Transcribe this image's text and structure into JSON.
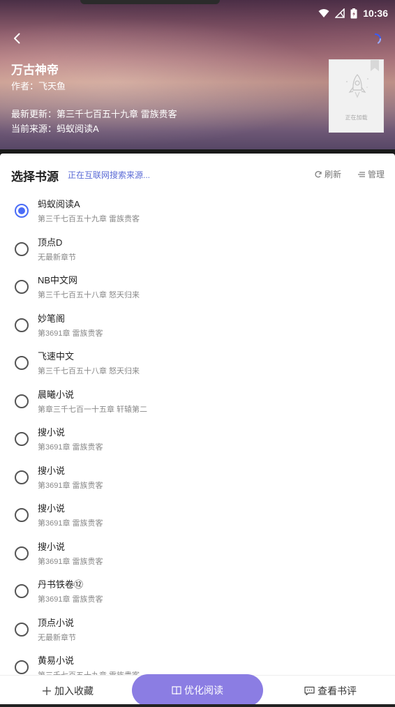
{
  "status_bar": {
    "time": "10:36"
  },
  "book": {
    "title": "万古神帝",
    "author": "作者：飞天鱼",
    "latest_update": "最新更新：第三千七百五十九章 雷族贵客",
    "current_source": "当前来源：蚂蚁阅读A",
    "cover_placeholder": "正在加载"
  },
  "panel": {
    "title": "选择书源",
    "search_status": "正在互联网搜索来源...",
    "refresh_label": "刷新",
    "manage_label": "管理"
  },
  "sources": [
    {
      "name": "蚂蚁阅读A",
      "chapter": "第三千七百五十九章 雷族贵客",
      "selected": true
    },
    {
      "name": "顶点D",
      "chapter": "无最新章节",
      "selected": false
    },
    {
      "name": "NB中文网",
      "chapter": "第三千七百五十八章 怒天归来",
      "selected": false
    },
    {
      "name": "妙笔阁",
      "chapter": "第3691章 雷族贵客",
      "selected": false
    },
    {
      "name": "飞速中文",
      "chapter": "第三千七百五十八章 怒天归来",
      "selected": false
    },
    {
      "name": "晨曦小说",
      "chapter": "第章三千七百一十五章 轩辕第二",
      "selected": false
    },
    {
      "name": "搜小说",
      "chapter": "第3691章 雷族贵客",
      "selected": false
    },
    {
      "name": "搜小说",
      "chapter": "第3691章 雷族贵客",
      "selected": false
    },
    {
      "name": "搜小说",
      "chapter": "第3691章 雷族贵客",
      "selected": false
    },
    {
      "name": "搜小说",
      "chapter": "第3691章 雷族贵客",
      "selected": false
    },
    {
      "name": "丹书铁卷⑫",
      "chapter": "第3691章 雷族贵客",
      "selected": false
    },
    {
      "name": "顶点小说",
      "chapter": "无最新章节",
      "selected": false
    },
    {
      "name": "黄易小说",
      "chapter": "第三千七百五十九章 雷族贵客",
      "selected": false
    }
  ],
  "bottom_bar": {
    "add_shelf": "加入收藏",
    "optimize_read": "优化阅读",
    "view_reviews": "查看书评"
  },
  "colors": {
    "accent": "#4a6cf7",
    "primary_button": "#8b7de3",
    "link": "#5b6bd6"
  }
}
